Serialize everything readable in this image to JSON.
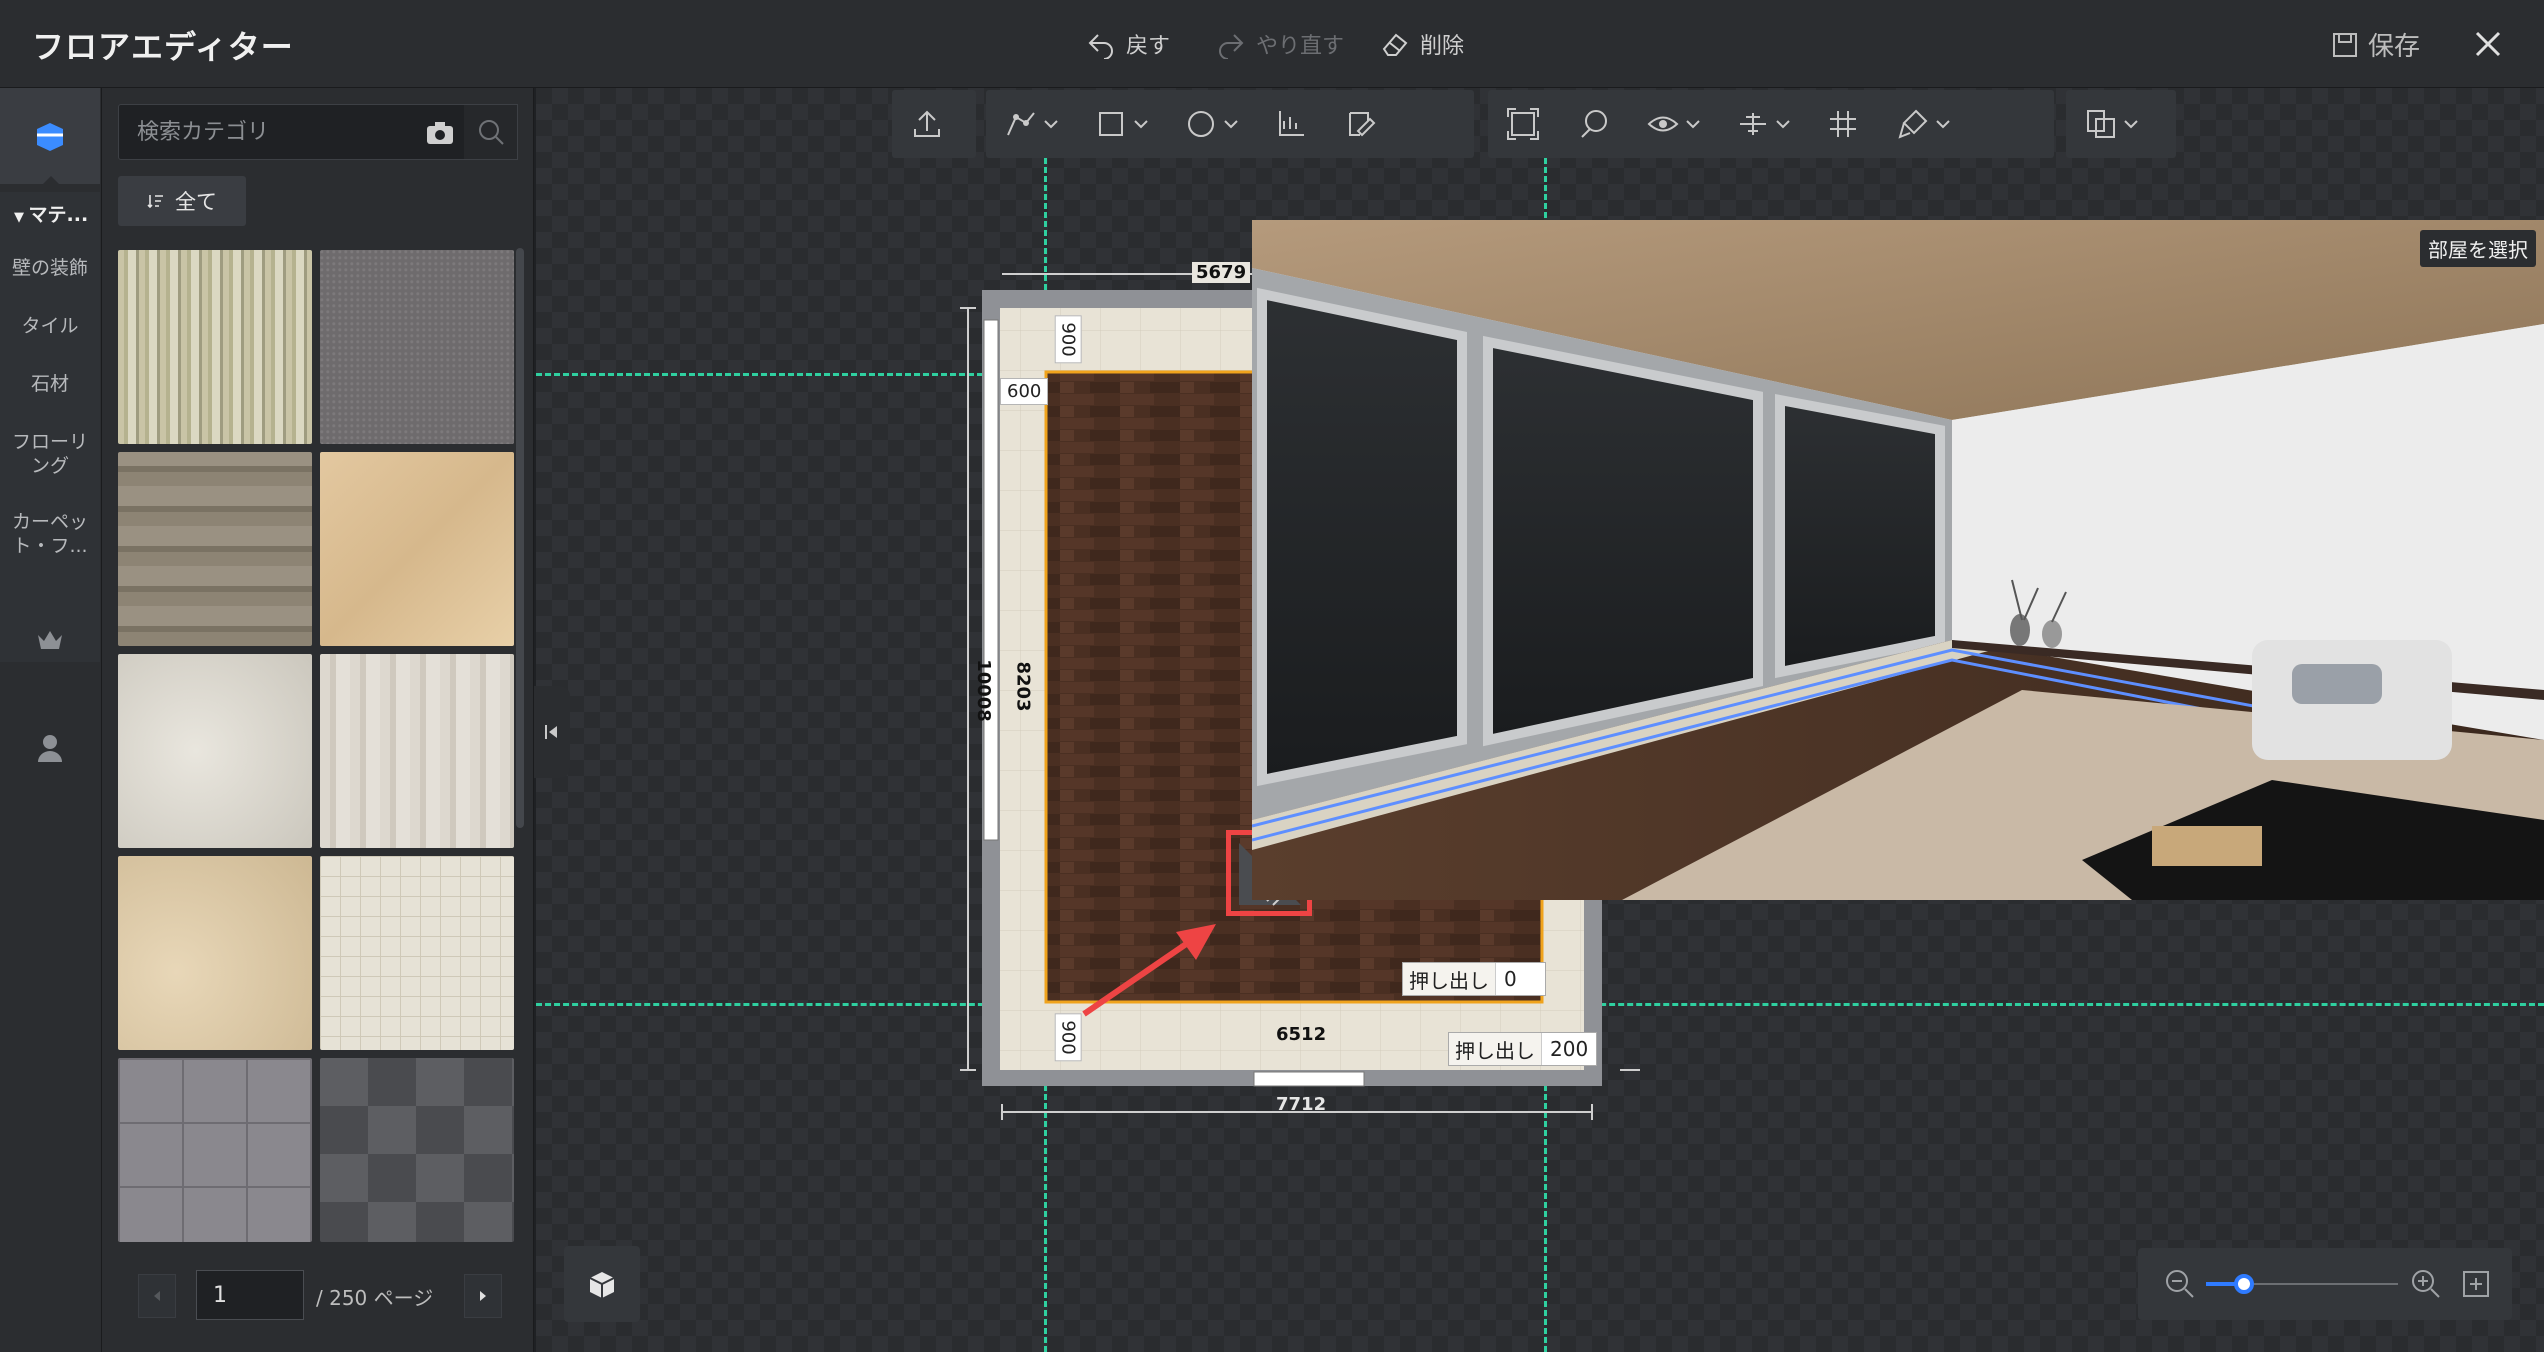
{
  "app": {
    "title": "フロアエディター",
    "undo_label": "戻す",
    "redo_label": "やり直す",
    "delete_label": "削除",
    "save_label": "保存"
  },
  "rail": {
    "heading": "マテ...",
    "items": [
      {
        "label": "壁の装飾"
      },
      {
        "label": "タイル"
      },
      {
        "label": "石材"
      },
      {
        "label": "フローリング"
      },
      {
        "label": "カーペット・フ..."
      }
    ]
  },
  "panel": {
    "search_placeholder": "検索カテゴリ",
    "all_label": "全て",
    "page_value": "1",
    "page_total": "/ 250 ページ"
  },
  "toolbar": {
    "icons": [
      "upload-icon",
      "draw-wall-icon",
      "rectangle-icon",
      "circle-icon",
      "measure-icon",
      "edit-icon",
      "select-area-icon",
      "lasso-icon",
      "eye-icon",
      "align-icon",
      "grid-icon",
      "paint-icon",
      "copy-icon"
    ]
  },
  "plan": {
    "dim_top": "5679",
    "dim_left_outer": "10008",
    "dim_left_inner": "8203",
    "dim_top_offset": "900",
    "dim_left_offset": "600",
    "dim_bottom_offset": "900",
    "dim_bottom_inner": "6512",
    "dim_bottom_outer": "7712",
    "extrude_label": "押し出し",
    "extrude_inner_value": "0",
    "extrude_outer_value": "200"
  },
  "preview": {
    "select_room_label": "部屋を選択"
  },
  "zoom": {
    "level_fraction": 0.2
  },
  "colors": {
    "accent": "#2f7bff",
    "guide": "#2fd0a0",
    "highlight": "#ee4444",
    "wood_floor": "#4a2f22"
  }
}
